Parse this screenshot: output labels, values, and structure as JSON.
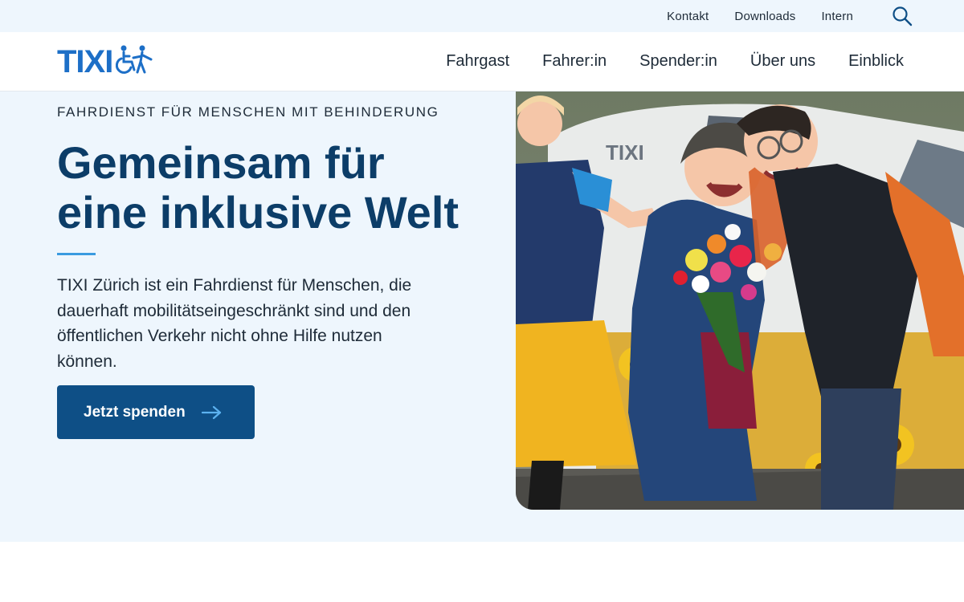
{
  "topbar": {
    "links": [
      "Kontakt",
      "Downloads",
      "Intern"
    ],
    "search_icon": "search-icon"
  },
  "brand": {
    "logo_text": "TIXI",
    "logo_icon": "wheelchair-people-icon",
    "color": "#1d6fc7"
  },
  "nav": {
    "items": [
      "Fahrgast",
      "Fahrer:in",
      "Spender:in",
      "Über uns",
      "Einblick"
    ]
  },
  "hero": {
    "eyebrow": "FAHRDIENST FÜR MENSCHEN MIT BEHINDERUNG",
    "headline_line1": "Gemeinsam für",
    "headline_line2": "eine inklusive Welt",
    "lead": "TIXI Zürich ist ein Fahrdienst für Menschen, die dauerhaft mobilitätseingeschränkt sind und den öffentlichen Verkehr nicht ohne Hilfe nutzen können.",
    "cta_label": "Jetzt spenden",
    "cta_icon": "arrow-right-icon",
    "photo_van_text": "TIXI"
  },
  "colors": {
    "hero_bg": "#eef6fd",
    "headline": "#0c3d68",
    "button": "#0e4f86",
    "accent": "#3a9be0"
  }
}
